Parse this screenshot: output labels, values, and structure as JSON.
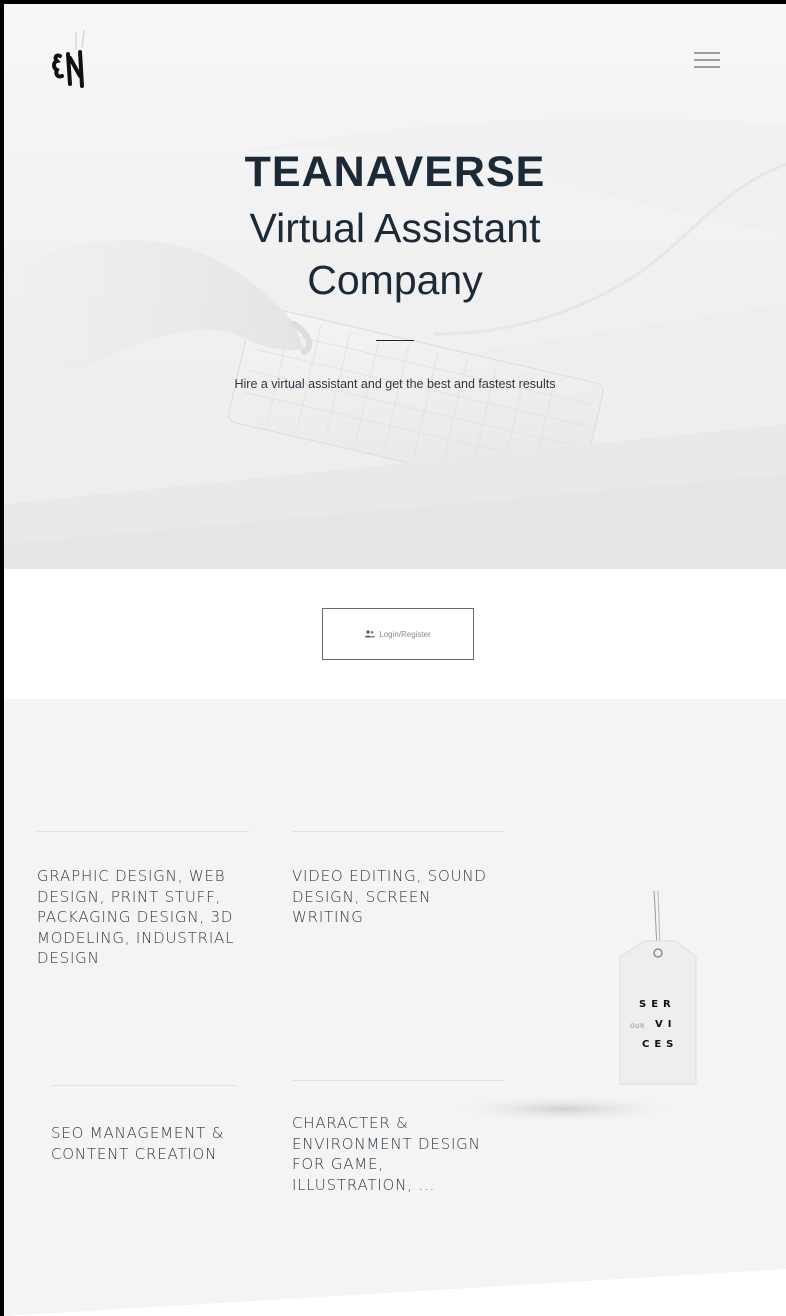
{
  "header": {
    "menu_icon": "hamburger-menu-icon",
    "logo_icon": "teanaverse-logo-icon"
  },
  "hero": {
    "title": "TEANAVERSE",
    "subtitle": "Virtual Assistant Company",
    "tagline": "Hire a virtual assistant and get the best and fastest results"
  },
  "login": {
    "label": "Login/Register",
    "icon": "users-icon"
  },
  "services": {
    "items": [
      {
        "text": "GRAPHIC DESIGN, WEB DESIGN, PRINT STUFF, PACKAGING DESIGN, 3D MODELING, INDUSTRIAL DESIGN"
      },
      {
        "text": "VIDEO EDITING, SOUND DESIGN, SCREEN WRITING"
      },
      {
        "text": "SEO MANAGEMENT & CONTENT CREATION"
      },
      {
        "text": "CHARACTER & ENVIRONMENT DESIGN FOR GAME, ILLUSTRATION, ..."
      }
    ],
    "tag": {
      "line1": "SER",
      "line2": "VI",
      "line3": "CES",
      "small": "OUR"
    }
  }
}
